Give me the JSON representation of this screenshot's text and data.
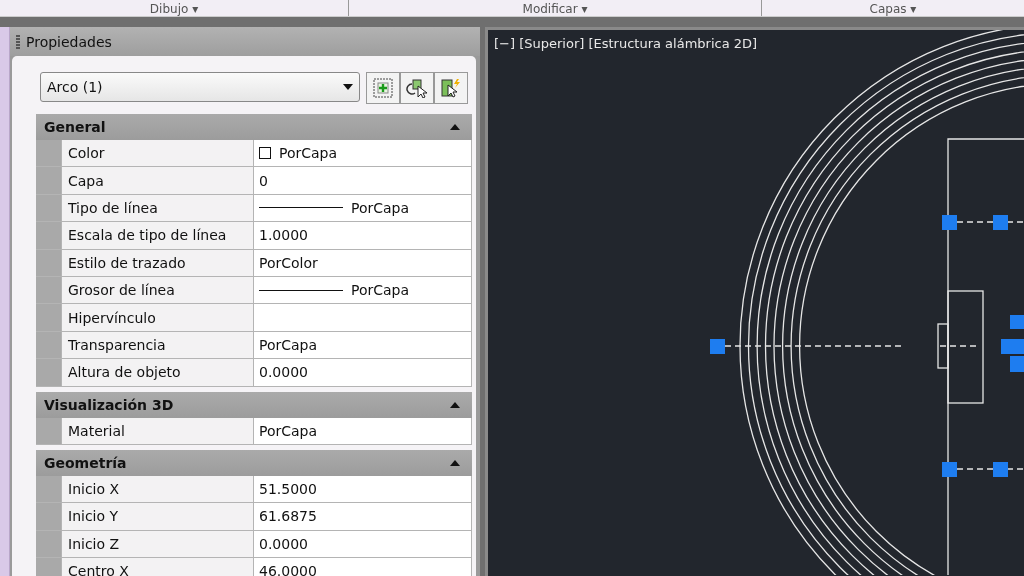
{
  "ribbon": {
    "panels": [
      {
        "label": "Dibujo ▾"
      },
      {
        "label": "Modificar ▾"
      },
      {
        "label": "Capas ▾"
      }
    ]
  },
  "palette": {
    "title": "Propiedades",
    "selector": {
      "value": "Arco (1)"
    },
    "sections": [
      {
        "title": "General",
        "expanded": true,
        "rows": [
          {
            "label": "Color",
            "value": "PorCapa",
            "kind": "swatch"
          },
          {
            "label": "Capa",
            "value": "0",
            "kind": "text"
          },
          {
            "label": "Tipo de línea",
            "value": "PorCapa",
            "kind": "line"
          },
          {
            "label": "Escala de tipo de línea",
            "value": "1.0000",
            "kind": "text"
          },
          {
            "label": "Estilo de trazado",
            "value": "PorColor",
            "kind": "text"
          },
          {
            "label": "Grosor de línea",
            "value": "PorCapa",
            "kind": "line"
          },
          {
            "label": "Hipervínculo",
            "kind": "text"
          },
          {
            "label": "Transparencia",
            "value": "PorCapa",
            "kind": "text"
          },
          {
            "label": "Altura de objeto",
            "value": "0.0000",
            "kind": "text"
          }
        ]
      },
      {
        "title": "Visualización 3D",
        "expanded": true,
        "rows": [
          {
            "label": "Material",
            "value": "PorCapa",
            "kind": "text"
          }
        ]
      },
      {
        "title": "Geometría",
        "expanded": true,
        "rows": [
          {
            "label": "Inicio X",
            "value": "51.5000",
            "kind": "text"
          },
          {
            "label": "Inicio Y",
            "value": "61.6875",
            "kind": "text"
          },
          {
            "label": "Inicio Z",
            "value": "0.0000",
            "kind": "text"
          },
          {
            "label": "Centro X",
            "value": "46.0000",
            "kind": "text"
          }
        ]
      }
    ]
  },
  "viewport": {
    "label": "[−] [Superior] [Estructura alámbrica 2D]"
  }
}
